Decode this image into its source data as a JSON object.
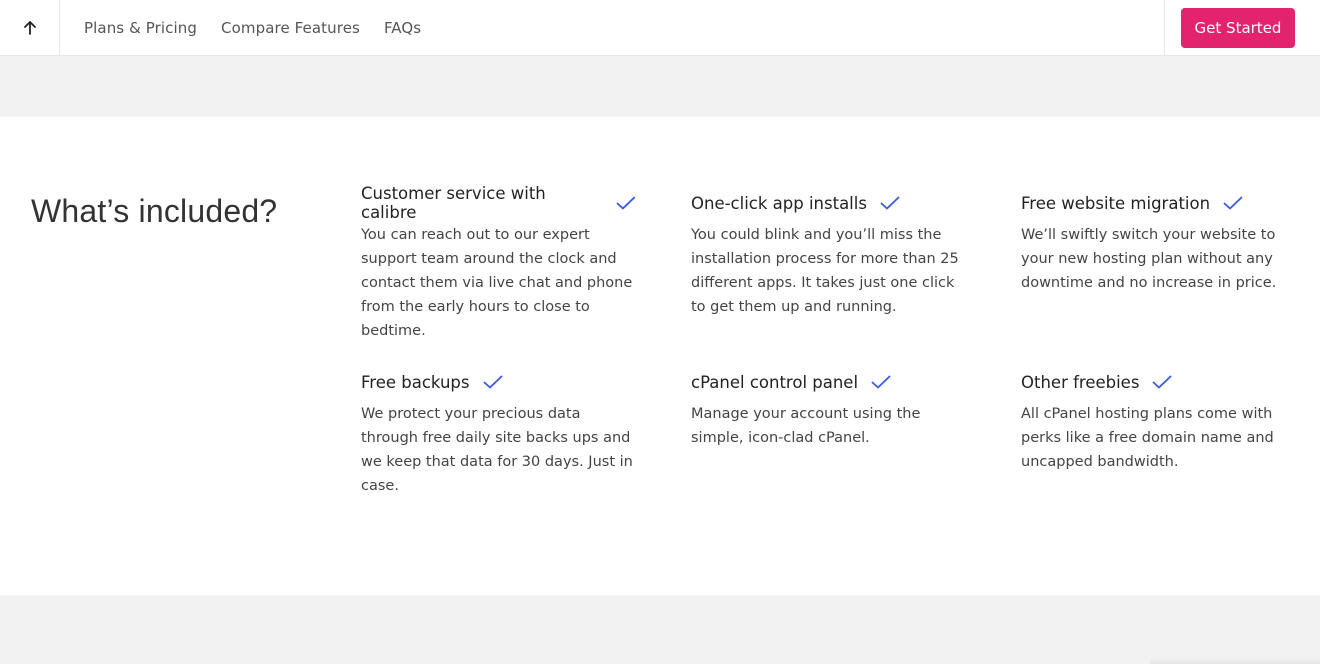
{
  "nav": {
    "links": [
      "Plans & Pricing",
      "Compare Features",
      "FAQs"
    ],
    "cta_label": "Get Started"
  },
  "section": {
    "title": "What’s included?",
    "features": [
      {
        "title": "Customer service with calibre",
        "description": "You can reach out to our expert support team around the clock and contact them via live chat and phone from the early hours to close to bedtime."
      },
      {
        "title": "One-click app installs",
        "description": "You could blink and you’ll miss the installation process for more than 25 different apps. It takes just one click to get them up and running."
      },
      {
        "title": "Free website migration",
        "description": "We’ll swiftly switch your website to your new hosting plan without any downtime and no increase in price."
      },
      {
        "title": "Free backups",
        "description": "We protect your precious data through free daily site backs ups and we keep that data for 30 days. Just in case."
      },
      {
        "title": "cPanel control panel",
        "description": "Manage your account using the simple, icon-clad cPanel."
      },
      {
        "title": "Other freebies",
        "description": "All cPanel hosting plans come with perks like a free domain name and uncapped bandwidth."
      }
    ]
  },
  "colors": {
    "accent": "#e4236f",
    "check": "#3b5bdb",
    "band": "#f2f2f2"
  },
  "icons": {
    "back_to_top": "arrow-up-icon",
    "feature_check": "check-icon"
  }
}
